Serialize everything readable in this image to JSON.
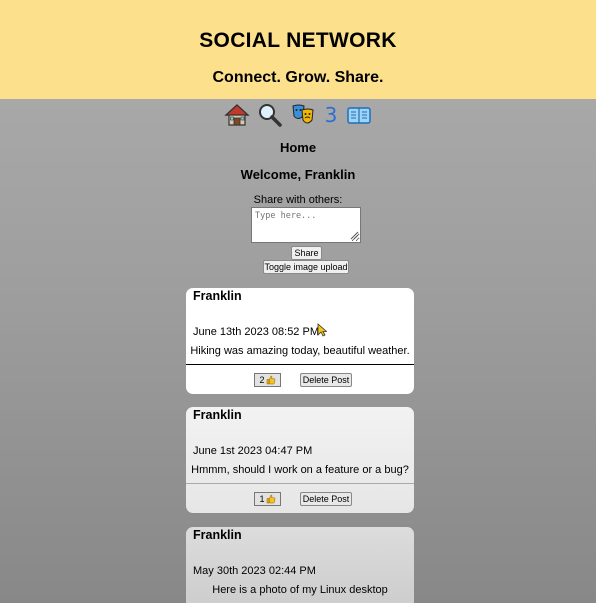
{
  "header": {
    "title": "SOCIAL NETWORK",
    "tagline": "Connect. Grow. Share.",
    "background": "#fce08c"
  },
  "nav": {
    "items": [
      {
        "icon": "home-icon"
      },
      {
        "icon": "search-icon"
      },
      {
        "icon": "theater-masks-icon"
      },
      {
        "icon": "newspaper-icon"
      }
    ],
    "notification_count": "3",
    "count_color": "#2d6fd0"
  },
  "page": {
    "heading": "Home",
    "welcome": "Welcome, Franklin"
  },
  "share": {
    "label": "Share with others:",
    "placeholder": "Type here...",
    "share_button": "Share",
    "toggle_button": "Toggle image upload"
  },
  "posts": [
    {
      "author": "Franklin",
      "date": "June 13th 2023 08:52 PM",
      "content": "Hiking was amazing today, beautiful weather.",
      "likes": "2",
      "delete_label": "Delete Post"
    },
    {
      "author": "Franklin",
      "date": "June 1st 2023 04:47 PM",
      "content": "Hmmm, should I work on a feature or a bug?",
      "likes": "1",
      "delete_label": "Delete Post"
    },
    {
      "author": "Franklin",
      "date": "May 30th 2023 02:44 PM",
      "content": "Here is a photo of my Linux desktop"
    }
  ]
}
